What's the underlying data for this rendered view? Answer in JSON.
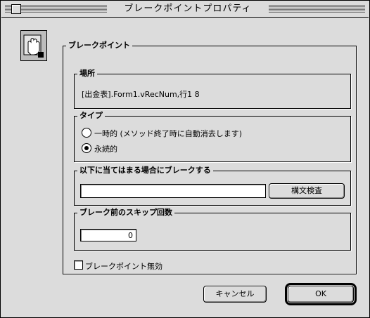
{
  "window": {
    "title": "ブレークポイントプロパティ"
  },
  "icon": {
    "name": "breakpoint-hand-icon"
  },
  "breakpoint_group": {
    "label": "ブレークポイント"
  },
  "location_group": {
    "label": "場所",
    "value": "[出金表].Form1.vRecNum,行1 8"
  },
  "type_group": {
    "label": "タイプ",
    "options": [
      {
        "label": "一時的 (メソッド終了時に自動消去します)",
        "selected": false
      },
      {
        "label": "永続的",
        "selected": true
      }
    ]
  },
  "condition_group": {
    "label": "以下に当てはまる場合にブレークする",
    "value": "",
    "check_button": "構文検査"
  },
  "skip_group": {
    "label": "ブレーク前のスキップ回数",
    "value": "0"
  },
  "disable_checkbox": {
    "label": "ブレークポイント無効",
    "checked": false
  },
  "buttons": {
    "cancel": "キャンセル",
    "ok": "OK"
  }
}
